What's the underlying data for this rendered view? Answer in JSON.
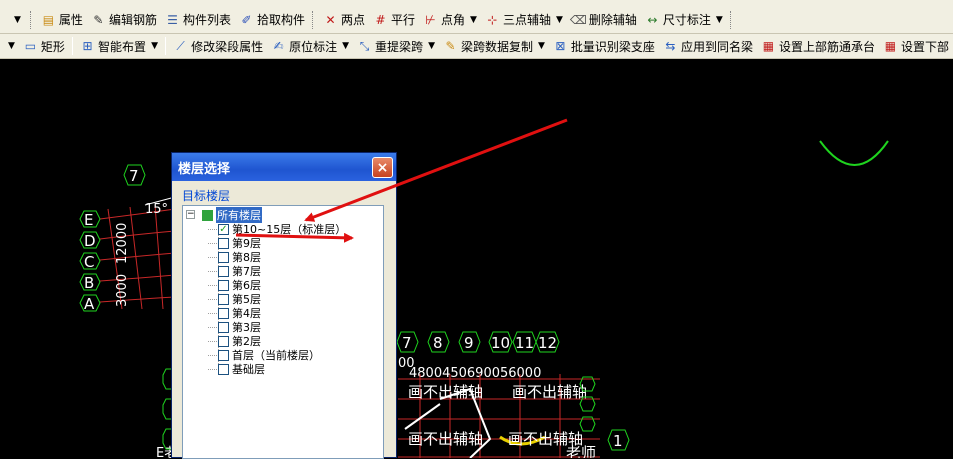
{
  "toolbar1": {
    "items": [
      {
        "label": "属性",
        "icon": "properties-icon"
      },
      {
        "label": "编辑钢筋",
        "icon": "edit-rebar-icon"
      },
      {
        "label": "构件列表",
        "icon": "component-list-icon"
      },
      {
        "label": "拾取构件",
        "icon": "pick-component-icon"
      },
      {
        "label": "两点",
        "icon": "two-point-icon"
      },
      {
        "label": "平行",
        "icon": "parallel-icon"
      },
      {
        "label": "点角",
        "icon": "point-angle-icon"
      },
      {
        "label": "三点辅轴",
        "icon": "three-point-axis-icon"
      },
      {
        "label": "删除辅轴",
        "icon": "delete-axis-icon"
      },
      {
        "label": "尺寸标注",
        "icon": "dimension-icon"
      }
    ]
  },
  "toolbar2": {
    "items": [
      {
        "label": "矩形",
        "icon": "rectangle-icon"
      },
      {
        "label": "智能布置",
        "icon": "smart-layout-icon"
      },
      {
        "label": "修改梁段属性",
        "icon": "modify-beam-icon"
      },
      {
        "label": "原位标注",
        "icon": "inplace-annotation-icon"
      },
      {
        "label": "重提梁跨",
        "icon": "re-extract-span-icon"
      },
      {
        "label": "梁跨数据复制",
        "icon": "copy-span-data-icon"
      },
      {
        "label": "批量识别梁支座",
        "icon": "batch-identify-icon"
      },
      {
        "label": "应用到同名梁",
        "icon": "apply-same-name-icon"
      },
      {
        "label": "设置上部筋通承台",
        "icon": "set-top-rebar-icon"
      },
      {
        "label": "设置下部",
        "icon": "set-bottom-icon"
      }
    ]
  },
  "dialog": {
    "title": "楼层选择",
    "close": "×",
    "group_label": "目标楼层",
    "root": "所有楼层",
    "floors": [
      {
        "label": "第10~15层（标准层）",
        "checked": true
      },
      {
        "label": "第9层",
        "checked": false
      },
      {
        "label": "第8层",
        "checked": false
      },
      {
        "label": "第7层",
        "checked": false
      },
      {
        "label": "第6层",
        "checked": false
      },
      {
        "label": "第5层",
        "checked": false
      },
      {
        "label": "第4层",
        "checked": false
      },
      {
        "label": "第3层",
        "checked": false
      },
      {
        "label": "第2层",
        "checked": false
      },
      {
        "label": "首层（当前楼层）",
        "checked": false
      },
      {
        "label": "基础层",
        "checked": false
      }
    ]
  },
  "canvas": {
    "axis_left": [
      "E",
      "D",
      "C",
      "B",
      "A"
    ],
    "axis_top_left": "7",
    "axis_numbers": [
      "7",
      "8",
      "9",
      "10",
      "11",
      "12"
    ],
    "axis_right": "1",
    "angle_label": "15°",
    "dims_vertical": "3000",
    "dims_vertical2": "12000",
    "dims_row": "4800450690056000",
    "cad_text1": "画不出辅轴",
    "cad_text2": "画不出辅轴",
    "cad_text3": "画不出辅轴",
    "cad_text4": "画不出辅轴",
    "cad_text5": "老师",
    "cad_text6": "E老",
    "cad_text7": "00"
  },
  "colors": {
    "annotation_arrow": "#e01010",
    "axis_green": "#1fd41f",
    "toolbar_bg": "#f1efe2",
    "canvas_bg": "#000000"
  }
}
